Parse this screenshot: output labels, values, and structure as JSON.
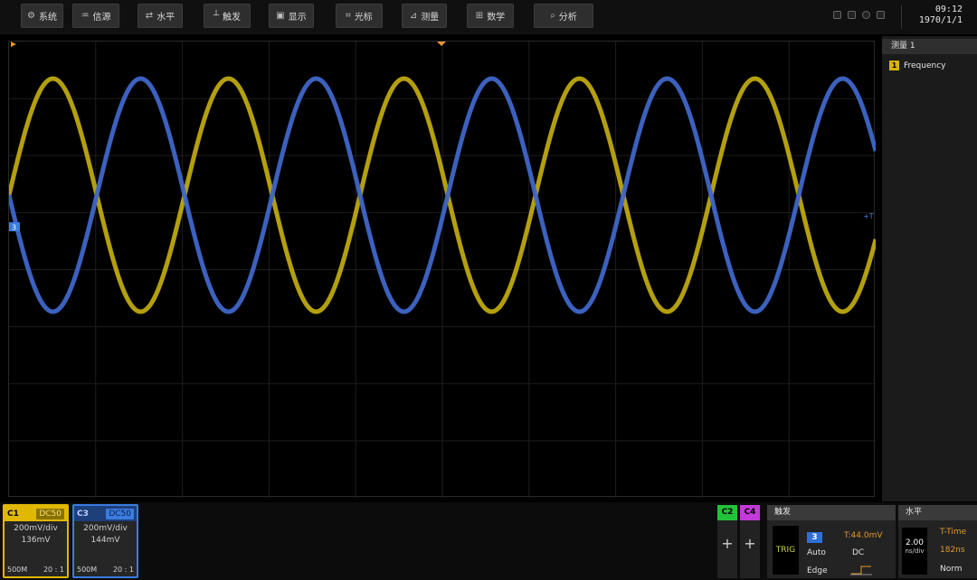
{
  "menu": [
    {
      "icon": "gear-icon",
      "glyph": "⚙",
      "label": "系统"
    },
    {
      "icon": "signal-source-icon",
      "glyph": "♒",
      "label": "信源"
    },
    {
      "icon": "horizontal-icon",
      "glyph": "⇄",
      "label": "水平"
    },
    {
      "icon": "trigger-icon",
      "glyph": "┴",
      "label": "触发"
    },
    {
      "icon": "display-icon",
      "glyph": "▣",
      "label": "显示"
    },
    {
      "icon": "cursor-icon",
      "glyph": "⌗",
      "label": "光标"
    },
    {
      "icon": "measure-icon",
      "glyph": "⊿",
      "label": "测量"
    },
    {
      "icon": "math-icon",
      "glyph": "⊞",
      "label": "数学"
    },
    {
      "icon": "analysis-icon",
      "glyph": "⌕",
      "label": "分析"
    }
  ],
  "clock": {
    "time": "09:12",
    "date": "1970/1/1"
  },
  "side_panel": {
    "title": "测量 1",
    "items": [
      {
        "channel": "1",
        "label": "Frequency"
      }
    ]
  },
  "waveforms": {
    "yellow_color": "#c8b010",
    "blue_color": "#3f66c8",
    "marker_left": "3",
    "marker_right": "+T"
  },
  "channels": {
    "c1": {
      "name": "C1",
      "coupling": "DC50",
      "scale": "200mV/div",
      "offset": "136mV",
      "bandwidth": "500M",
      "ratio": "20 : 1",
      "color": "#e0b800"
    },
    "c3": {
      "name": "C3",
      "coupling": "DC50",
      "scale": "200mV/div",
      "offset": "144mV",
      "bandwidth": "500M",
      "ratio": "20 : 1",
      "color": "#3a7be0"
    },
    "c2": {
      "name": "C2",
      "plus": "+",
      "color": "#22c23a"
    },
    "c4": {
      "name": "C4",
      "plus": "+",
      "color": "#c23ad8"
    }
  },
  "trigger": {
    "title": "触发",
    "label": "TRIG",
    "source": "3",
    "level": "T:44.0mV",
    "mode": "Auto",
    "coupling": "DC",
    "type": "Edge"
  },
  "horizontal": {
    "title": "水平",
    "scale_value": "2.00",
    "scale_unit": "ns/div",
    "t_time": "T-Time",
    "delay": "182ns",
    "mode": "Norm"
  }
}
